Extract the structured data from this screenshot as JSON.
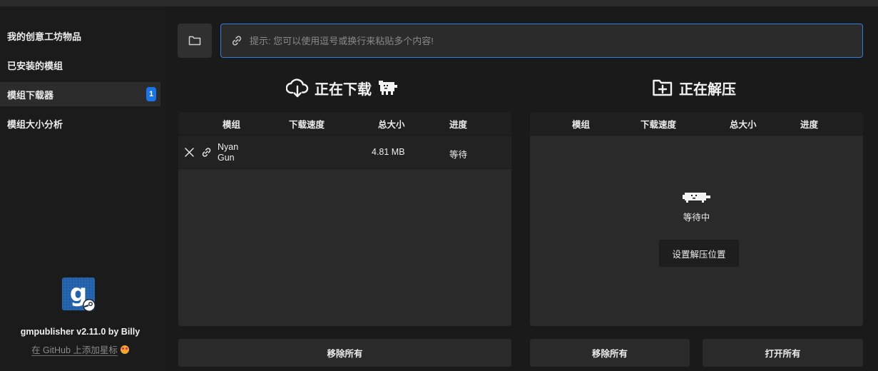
{
  "sidebar": {
    "items": [
      {
        "label": "我的创意工坊物品"
      },
      {
        "label": "已安装的模组"
      },
      {
        "label": "模组下载器",
        "badge": "1"
      },
      {
        "label": "模组大小分析"
      }
    ],
    "version": "gmpublisher v2.11.0 by Billy",
    "github_link": "在 GitHub 上添加星标"
  },
  "link_input": {
    "placeholder": "提示: 您可以使用逗号或换行来粘贴多个内容!",
    "value": ""
  },
  "downloading": {
    "title": "正在下载",
    "headers": [
      "模组",
      "下载速度",
      "总大小",
      "进度"
    ],
    "rows": [
      {
        "name_line1": "Nyan",
        "name_line2": "Gun",
        "speed": "",
        "size": "4.81 MB",
        "progress": "等待"
      }
    ],
    "remove_all": "移除所有"
  },
  "extracting": {
    "title": "正在解压",
    "headers": [
      "模组",
      "下载速度",
      "总大小",
      "进度"
    ],
    "empty_text": "等待中",
    "set_location": "设置解压位置",
    "remove_all": "移除所有",
    "open_all": "打开所有"
  },
  "colors": {
    "accent": "#2f7fe0",
    "badge": "#1a73e8",
    "background": "#1a1a1a",
    "panel": "#2a2a2a"
  },
  "icons": [
    "folder-icon",
    "link-icon",
    "cloud-download-icon",
    "dog-icon",
    "folder-plus-icon",
    "close-icon",
    "steam-icon"
  ]
}
